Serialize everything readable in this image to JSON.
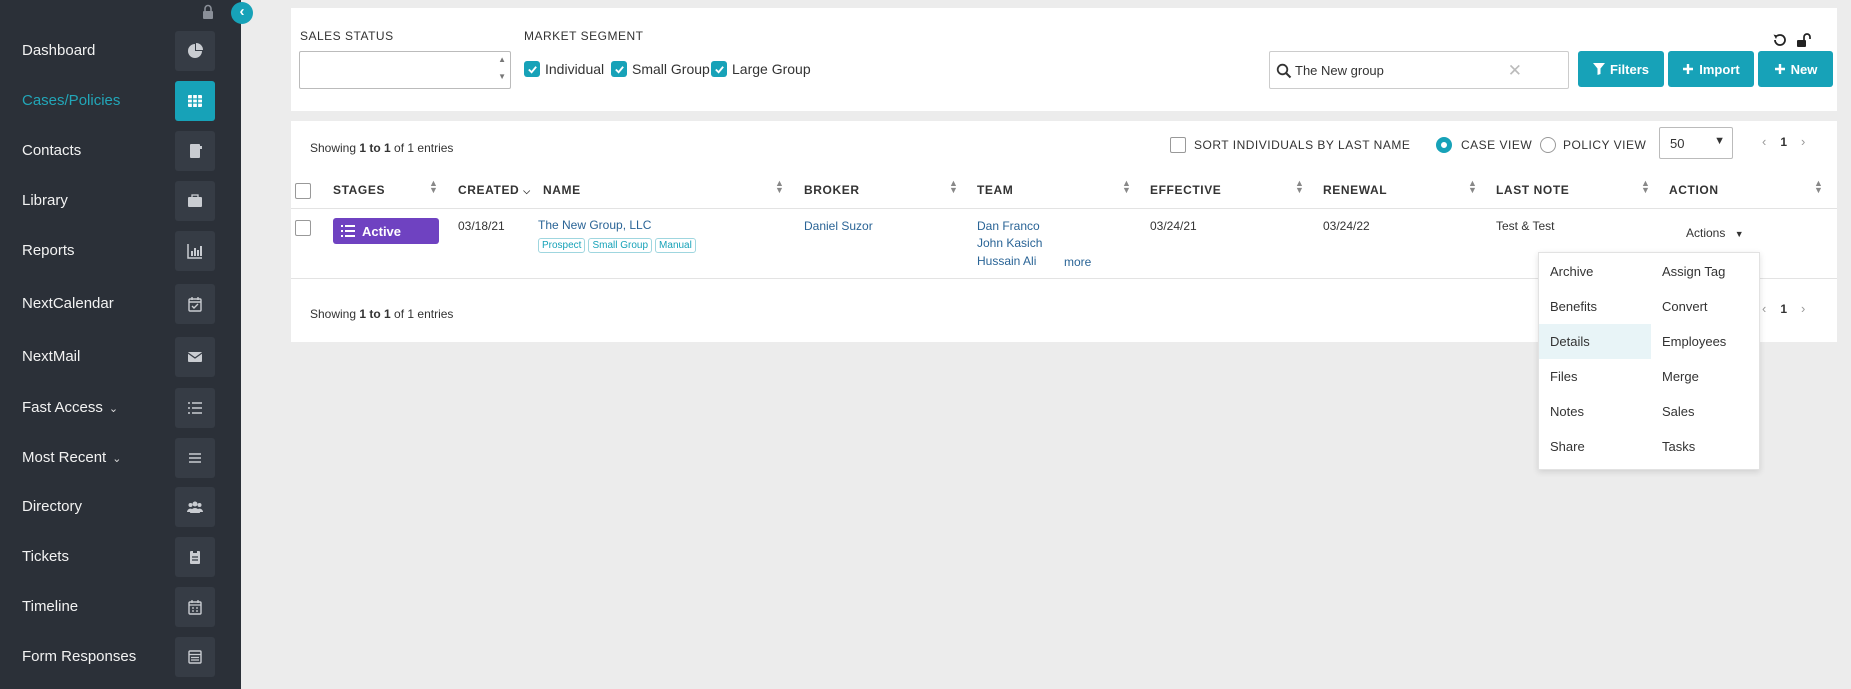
{
  "sidebar": {
    "items": [
      {
        "label": "Dashboard",
        "icon": "pie-chart-icon"
      },
      {
        "label": "Cases/Policies",
        "icon": "table-icon",
        "active": true
      },
      {
        "label": "Contacts",
        "icon": "address-book-icon"
      },
      {
        "label": "Library",
        "icon": "briefcase-icon"
      },
      {
        "label": "Reports",
        "icon": "bar-chart-icon"
      },
      {
        "label": "NextCalendar",
        "icon": "calendar-check-icon"
      },
      {
        "label": "NextMail",
        "icon": "envelope-icon"
      },
      {
        "label": "Fast Access",
        "icon": "list-icon",
        "dropdown": true
      },
      {
        "label": "Most Recent",
        "icon": "bars-icon",
        "dropdown": true
      },
      {
        "label": "Directory",
        "icon": "users-icon"
      },
      {
        "label": "Tickets",
        "icon": "clipboard-icon"
      },
      {
        "label": "Timeline",
        "icon": "calendar-icon"
      },
      {
        "label": "Form Responses",
        "icon": "form-icon"
      }
    ]
  },
  "filters": {
    "sales_status_label": "SALES STATUS",
    "market_segment_label": "MARKET SEGMENT",
    "segments": [
      {
        "label": "Individual",
        "checked": true
      },
      {
        "label": "Small Group",
        "checked": true
      },
      {
        "label": "Large Group",
        "checked": true
      }
    ],
    "search_value": "The New group",
    "buttons": {
      "filters": "Filters",
      "import": "Import",
      "new": "New"
    }
  },
  "table": {
    "showing_prefix": "Showing ",
    "showing_range": "1 to 1",
    "showing_suffix": " of 1 entries",
    "sort_by_last_name": "SORT INDIVIDUALS BY LAST NAME",
    "case_view": "CASE VIEW",
    "policy_view": "POLICY VIEW",
    "page_size": "50",
    "current_page": "1",
    "headers": {
      "stages": "STAGES",
      "created": "CREATED",
      "name": "NAME",
      "broker": "BROKER",
      "team": "TEAM",
      "effective": "EFFECTIVE",
      "renewal": "RENEWAL",
      "last_note": "LAST NOTE",
      "action": "ACTION"
    },
    "row": {
      "stage": "Active",
      "created": "03/18/21",
      "name": "The New Group, LLC",
      "tags": [
        "Prospect",
        "Small Group",
        "Manual"
      ],
      "broker": "Daniel Suzor",
      "team": [
        "Dan Franco",
        "John Kasich",
        "Hussain Ali"
      ],
      "team_more": "more",
      "effective": "03/24/21",
      "renewal": "03/24/22",
      "last_note": "Test & Test",
      "actions_label": "Actions"
    }
  },
  "actions_menu": {
    "left": [
      "Archive",
      "Benefits",
      "Details",
      "Files",
      "Notes",
      "Share"
    ],
    "right": [
      "Assign Tag",
      "Convert",
      "Employees",
      "Merge",
      "Sales",
      "Tasks"
    ],
    "highlighted": "Details"
  },
  "colors": {
    "accent": "#17a2b8",
    "sidebar": "#2b3038",
    "status_active": "#6f42c1"
  }
}
